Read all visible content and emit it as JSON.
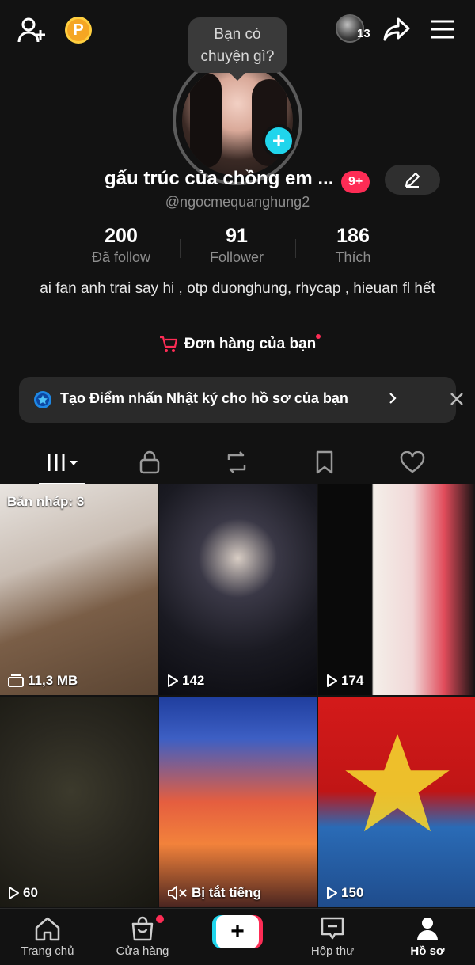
{
  "header": {
    "coin_letter": "P",
    "story_count": "13"
  },
  "profile": {
    "bubble_text": "Bạn có chuyện gì?",
    "display_name": "gấu trúc của chồng em ...",
    "notif_badge": "9+",
    "username": "@ngocmequanghung2",
    "bio": "ai fan anh trai say hi , otp duonghung, rhycap , hieuan fl hết",
    "orders_label": "Đơn hàng của bạn"
  },
  "stats": [
    {
      "value": "200",
      "label": "Đã follow"
    },
    {
      "value": "91",
      "label": "Follower"
    },
    {
      "value": "186",
      "label": "Thích"
    }
  ],
  "banner": {
    "text": "Tạo Điểm nhấn Nhật ký cho hồ sơ của bạn"
  },
  "tabs": [
    "videos",
    "private",
    "reposts",
    "saved",
    "liked"
  ],
  "videos": [
    {
      "draft_label": "Bản nháp: 3",
      "meta": "11,3 MB",
      "meta_icon": "draft-icon"
    },
    {
      "meta": "142",
      "meta_icon": "play-icon"
    },
    {
      "meta": "174",
      "meta_icon": "play-icon"
    },
    {
      "meta": "60",
      "meta_icon": "play-icon"
    },
    {
      "meta": "Bị tắt tiếng",
      "meta_icon": "muted-icon"
    },
    {
      "meta": "150",
      "meta_icon": "play-icon"
    }
  ],
  "nav": {
    "home": "Trang chủ",
    "shop": "Cửa hàng",
    "create": "+",
    "inbox": "Hộp thư",
    "profile": "Hồ sơ"
  },
  "colors": {
    "background": "#121212",
    "accent_red": "#fe2c55",
    "accent_cyan": "#20d5ec"
  }
}
